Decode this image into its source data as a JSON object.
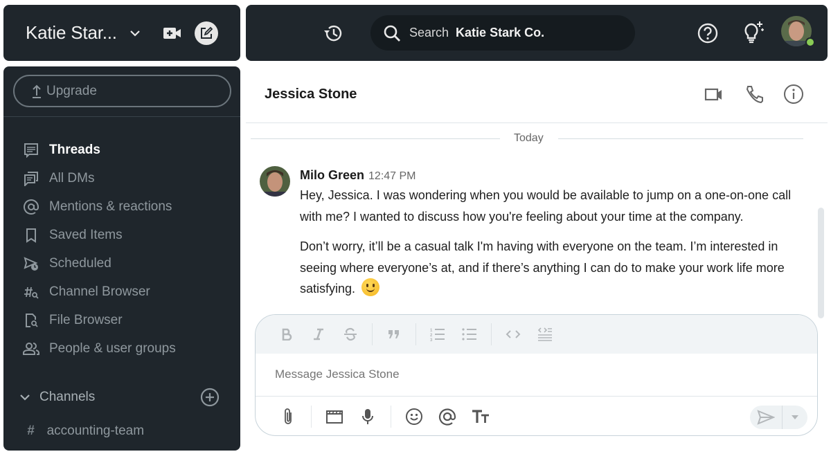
{
  "workspace": {
    "name": "Katie Star...",
    "colors": {
      "dark_panel": "#1f262c",
      "online": "#89cc55"
    }
  },
  "topbar": {
    "search_label": "Search",
    "search_scope": "Katie Stark Co."
  },
  "sidebar": {
    "upgrade_label": "Upgrade",
    "items": [
      {
        "label": "Threads",
        "icon": "threads-icon",
        "active": true
      },
      {
        "label": "All DMs",
        "icon": "dms-icon",
        "active": false
      },
      {
        "label": "Mentions & reactions",
        "icon": "at-icon",
        "active": false
      },
      {
        "label": "Saved Items",
        "icon": "bookmark-icon",
        "active": false
      },
      {
        "label": "Scheduled",
        "icon": "scheduled-icon",
        "active": false
      },
      {
        "label": "Channel Browser",
        "icon": "channel-search-icon",
        "active": false
      },
      {
        "label": "File Browser",
        "icon": "file-search-icon",
        "active": false
      },
      {
        "label": "People & user groups",
        "icon": "people-icon",
        "active": false
      }
    ],
    "channels_label": "Channels",
    "channels": [
      {
        "name": "accounting-team"
      }
    ]
  },
  "conversation": {
    "title": "Jessica Stone",
    "date_divider": "Today",
    "messages": [
      {
        "author": "Milo Green",
        "time": "12:47 PM",
        "paragraphs": [
          "Hey, Jessica. I was wondering when you would be available to jump on a one-on-one call with me? I wanted to discuss how you're feeling about your time at the company.",
          "Don’t worry, it’ll be a casual talk I'm having with everyone on the team. I’m interested in seeing where everyone’s at, and if there’s anything I can do to make your work life more satisfying."
        ],
        "emoji": "slightly-smiling-face"
      }
    ]
  },
  "composer": {
    "placeholder": "Message Jessica Stone",
    "format_buttons": [
      "bold",
      "italic",
      "strikethrough",
      "quote",
      "ordered-list",
      "bulleted-list",
      "code",
      "code-block"
    ],
    "action_buttons": [
      "attach",
      "video-clip",
      "voice",
      "emoji",
      "mention",
      "text-format"
    ]
  }
}
